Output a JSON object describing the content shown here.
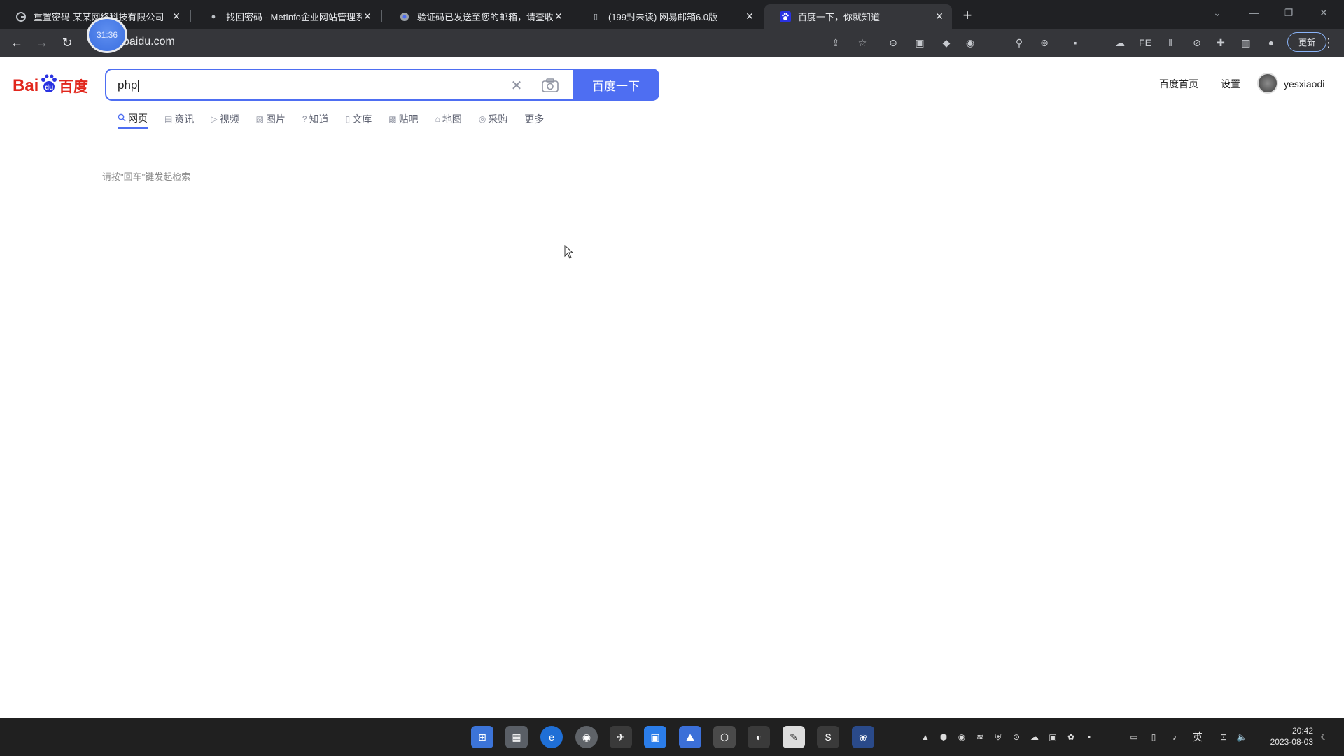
{
  "browser": {
    "tabs": [
      {
        "title": "重置密码-某某网络科技有限公司",
        "icon": "edge-icon",
        "active": false
      },
      {
        "title": "找回密码 - MetInfo企业网站管理系统",
        "icon": "metinfo-icon",
        "active": false
      },
      {
        "title": "验证码已发送至您的邮箱，请查收",
        "icon": "chrome-icon",
        "active": false
      },
      {
        "title": "(199封未读) 网易邮箱6.0版",
        "icon": "mail-icon",
        "active": false
      },
      {
        "title": "百度一下，你就知道",
        "icon": "baidu-paw-icon",
        "active": true
      }
    ],
    "address": "baidu.com",
    "update_label": "更新",
    "timer_badge": "31:36"
  },
  "page": {
    "search_query": "php",
    "search_button": "百度一下",
    "nav_tabs": [
      {
        "label": "网页",
        "icon": "search-icon",
        "active": true
      },
      {
        "label": "资讯",
        "icon": "news-icon",
        "active": false
      },
      {
        "label": "视频",
        "icon": "video-icon",
        "active": false
      },
      {
        "label": "图片",
        "icon": "image-icon",
        "active": false
      },
      {
        "label": "知道",
        "icon": "question-icon",
        "active": false
      },
      {
        "label": "文库",
        "icon": "doc-icon",
        "active": false
      },
      {
        "label": "贴吧",
        "icon": "tieba-icon",
        "active": false
      },
      {
        "label": "地图",
        "icon": "map-icon",
        "active": false
      },
      {
        "label": "采购",
        "icon": "purchase-icon",
        "active": false
      },
      {
        "label": "更多",
        "icon": "",
        "active": false
      }
    ],
    "hint": "请按\"回车\"键发起检索",
    "top_links": {
      "home": "百度首页",
      "settings": "设置"
    },
    "username": "yesxiaodi",
    "accent_color": "#4e6ef2"
  },
  "taskbar": {
    "ime_label": "英",
    "time": "20:42",
    "date": "2023-08-03"
  }
}
